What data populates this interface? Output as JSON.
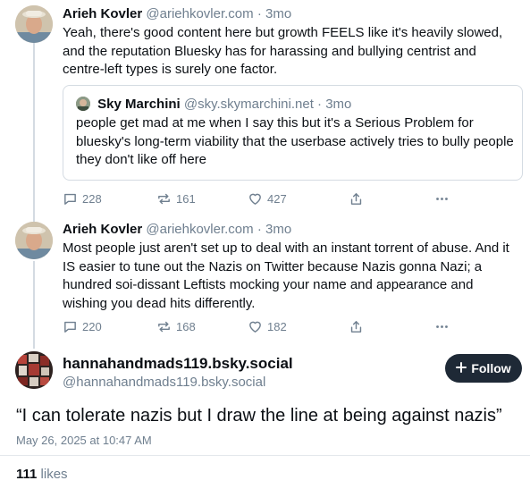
{
  "posts": [
    {
      "author": "Arieh Kovler",
      "handle": "@ariehkovler.com",
      "separator": "·",
      "age": "3mo",
      "text": "Yeah, there's good content here but growth FEELS like it's heavily slowed, and the reputation Bluesky has for harassing and bullying centrist and centre-left types is surely one factor.",
      "quote": {
        "author": "Sky Marchini",
        "handle": "@sky.skymarchini.net",
        "separator": "·",
        "age": "3mo",
        "text": "people get mad at me when I say this but it's a Serious Problem for bluesky's long-term viability that the userbase actively tries to bully people they don't like off here"
      },
      "replies": "228",
      "reposts": "161",
      "likes": "427"
    },
    {
      "author": "Arieh Kovler",
      "handle": "@ariehkovler.com",
      "separator": "·",
      "age": "3mo",
      "text": "Most people just aren't set up to deal with an instant torrent of abuse. And it IS easier to tune out the Nazis on Twitter because Nazis gonna Nazi; a hundred soi-dissant Leftists mocking your name and appearance and wishing you dead hits differently.",
      "replies": "220",
      "reposts": "168",
      "likes": "182"
    }
  ],
  "main_post": {
    "display_name": "hannahandmads119.bsky.social",
    "handle": "@hannahandmads119.bsky.social",
    "follow_label": "Follow",
    "text": "“I can tolerate nazis but I draw the line at being against nazis”",
    "timestamp": "May 26, 2025 at 10:47 AM",
    "like_count": "111",
    "like_label": "likes"
  },
  "icons": {
    "reply": "speech-bubble-icon",
    "repost": "repost-arrows-icon",
    "like": "heart-icon",
    "share": "share-icon",
    "more": "ellipsis-icon",
    "follow": "plus-icon"
  },
  "colors": {
    "text": "#0b0f14",
    "muted": "#6f7f8f",
    "thread_line": "#d4dbe2",
    "follow_button": "#1e2936"
  }
}
